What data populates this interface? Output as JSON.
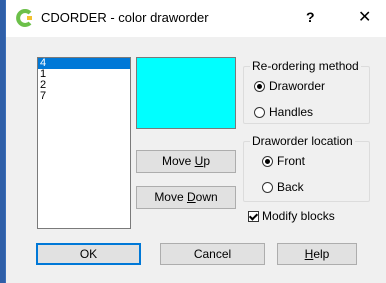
{
  "window": {
    "title": "CDORDER - color draworder",
    "help_glyph": "?",
    "close_glyph": "✕"
  },
  "color_list": {
    "items": [
      "4",
      "1",
      "2",
      "7"
    ],
    "selected_index": 0
  },
  "swatch": {
    "color": "#00ffff"
  },
  "buttons": {
    "move_up": {
      "before": "Move ",
      "key": "U",
      "after": "p"
    },
    "move_down": {
      "before": "Move ",
      "key": "D",
      "after": "own"
    },
    "ok": "OK",
    "cancel": "Cancel",
    "help": {
      "key": "H",
      "after": "elp"
    }
  },
  "reordering": {
    "title": "Re-ordering method",
    "options": [
      "Draworder",
      "Handles"
    ],
    "selected": "Draworder"
  },
  "location": {
    "title": "Draworder location",
    "options": [
      "Front",
      "Back"
    ],
    "selected": "Front"
  },
  "modify_blocks": {
    "label": "Modify blocks",
    "checked": true
  },
  "colors": {
    "accent": "#0078d7",
    "app_icon_green": "#6cc04a",
    "app_icon_yellow": "#f2c12e"
  }
}
